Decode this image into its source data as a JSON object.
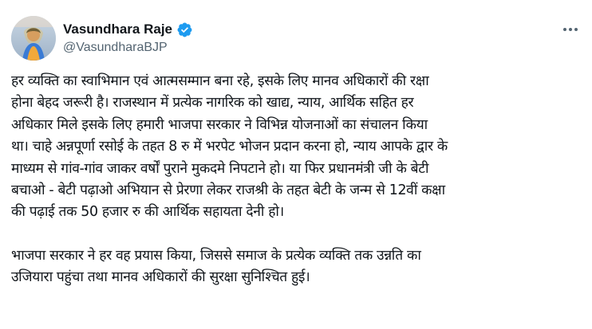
{
  "author": {
    "display_name": "Vasundhara Raje",
    "handle": "@VasundharaBJP",
    "verified": true,
    "verified_color": "#1d9bf0"
  },
  "icons": {
    "avatar": "profile-photo",
    "verified": "verified-badge-icon",
    "more": "more-options-icon"
  },
  "tweet": {
    "paragraph_1_lines": [
      "हर व्यक्ति का स्वाभिमान एवं आत्मसम्मान बना रहे, इसके लिए मानव अधिकारों की रक्षा",
      "होना बेहद जरूरी है। राजस्थान में प्रत्येक नागरिक को खाद्य, न्याय, आर्थिक सहित हर",
      "अधिकार मिले इसके लिए हमारी भाजपा सरकार ने विभिन्न योजनाओं का संचालन किया",
      "था। चाहे अन्नपूर्णा रसोई के तहत 8 रु में भरपेट भोजन प्रदान करना हो, न्याय आपके द्वार के",
      "माध्यम से गांव-गांव जाकर वर्षों पुराने मुकदमे निपटाने हो। या फिर प्रधानमंत्री जी के बेटी",
      "बचाओ - बेटी पढ़ाओ अभियान से प्रेरणा लेकर राजश्री के तहत बेटी के जन्म से 12वीं कक्षा",
      "की पढ़ाई तक 50 हजार रु की आर्थिक सहायता देनी हो।"
    ],
    "paragraph_2_lines": [
      "भाजपा सरकार ने हर वह प्रयास किया, जिससे समाज के प्रत्येक व्यक्ति तक उन्नति का",
      "उजियारा पहुंचा तथा मानव अधिकारों की सुरक्षा सुनिश्चित हुई।"
    ]
  }
}
